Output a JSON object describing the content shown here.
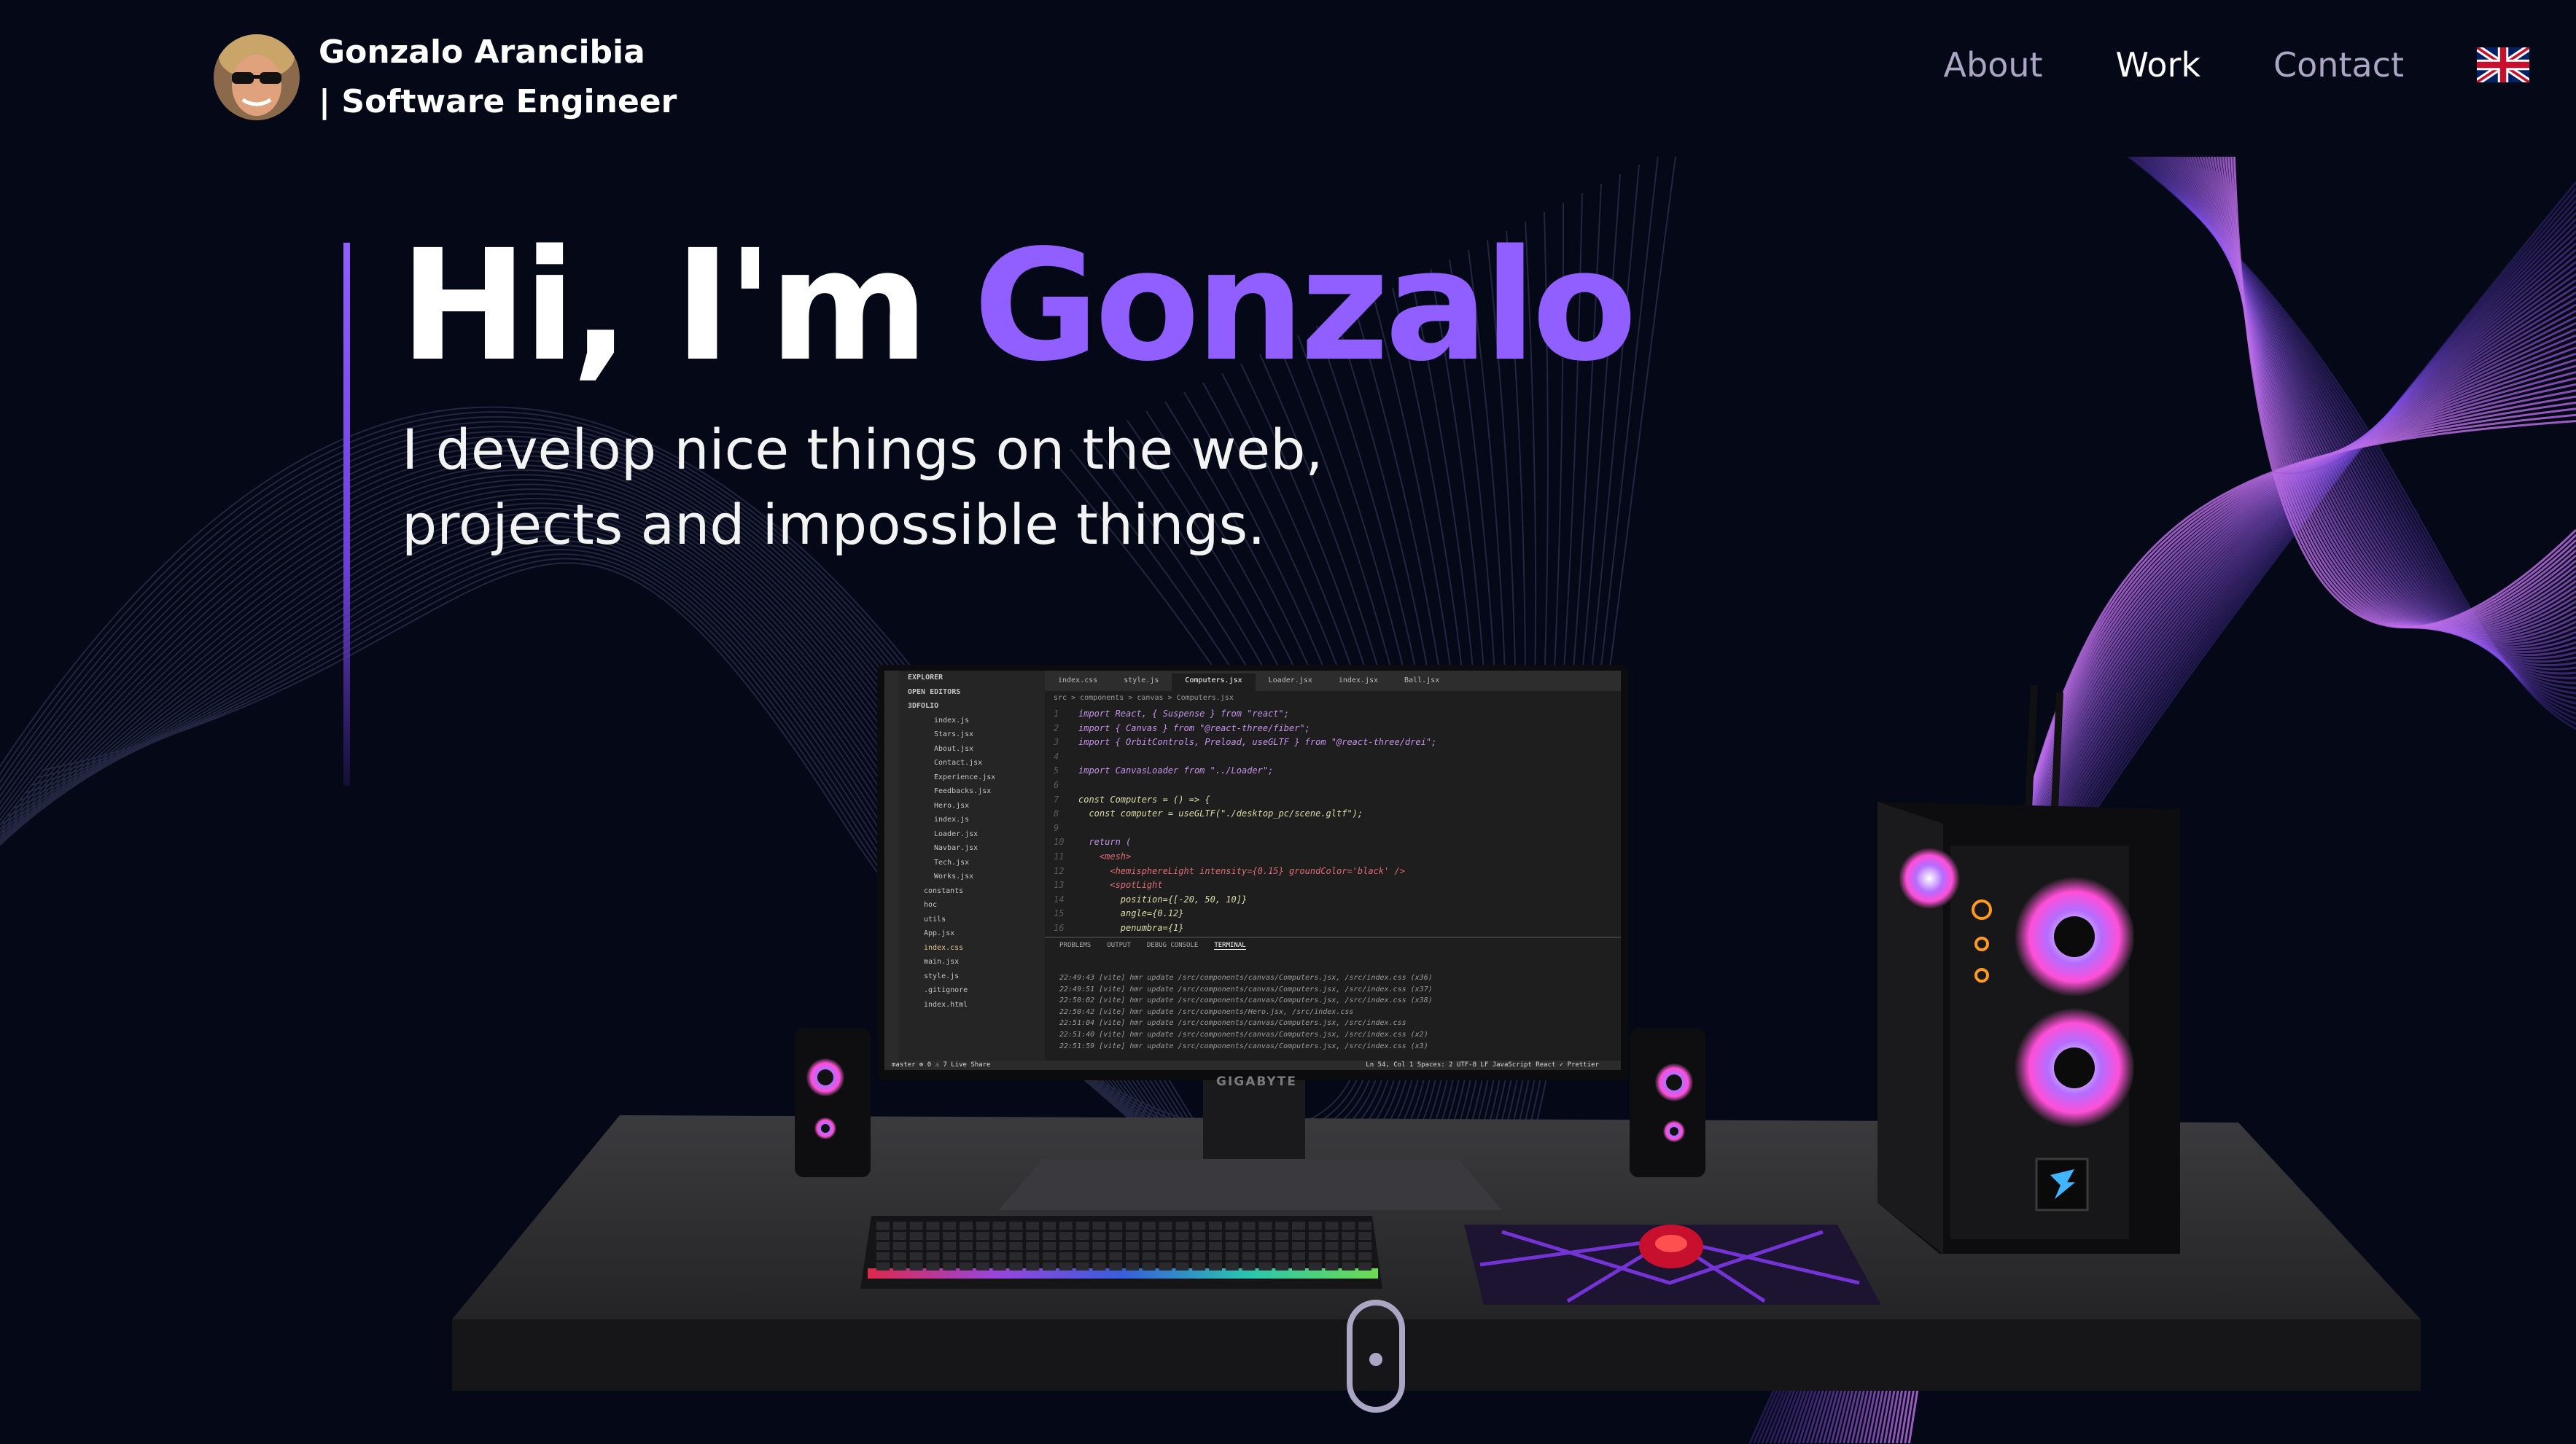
{
  "nav": {
    "name_line1": "Gonzalo Arancibia",
    "name_line2": "| Software Engineer",
    "links": [
      {
        "label": "About",
        "active": false
      },
      {
        "label": "Work",
        "active": true
      },
      {
        "label": "Contact",
        "active": false
      }
    ],
    "language_flag": "uk-flag-icon"
  },
  "hero": {
    "greeting": "Hi, I'm ",
    "name": "Gonzalo",
    "subtitle_line1": "I develop nice things on the web,",
    "subtitle_line2": "projects and impossible things."
  },
  "editor": {
    "tabs": [
      "index.css",
      "style.js",
      "Computers.jsx",
      "Loader.jsx",
      "index.jsx",
      "Ball.jsx"
    ],
    "breadcrumb": "src > components > canvas > Computers.jsx",
    "explorer_title": "EXPLORER",
    "open_editors": "OPEN EDITORS",
    "project": "3DFOLIO",
    "files": [
      "index.js",
      "Stars.jsx",
      "About.jsx",
      "Contact.jsx",
      "Experience.jsx",
      "Feedbacks.jsx",
      "Hero.jsx",
      "index.js",
      "Loader.jsx",
      "Navbar.jsx",
      "Tech.jsx",
      "Works.jsx",
      "constants",
      "hoc",
      "utils",
      "App.jsx",
      "index.css",
      "main.jsx",
      "style.js",
      ".gitignore",
      "index.html"
    ],
    "code_lines": [
      "import React, { Suspense } from \"react\";",
      "import { Canvas } from \"@react-three/fiber\";",
      "import { OrbitControls, Preload, useGLTF } from \"@react-three/drei\";",
      "",
      "import CanvasLoader from \"../Loader\";",
      "",
      "const Computers = () => {",
      "  const computer = useGLTF(\"./desktop_pc/scene.gltf\");",
      "",
      "  return (",
      "    <mesh>",
      "      <hemisphereLight intensity={0.15} groundColor='black' />",
      "      <spotLight",
      "        position={[-20, 50, 10]}",
      "        angle={0.12}",
      "        penumbra={1}"
    ],
    "panel_tabs": [
      "PROBLEMS",
      "OUTPUT",
      "DEBUG CONSOLE",
      "TERMINAL"
    ],
    "terminal_lines": [
      "22:49:43 [vite] hmr update /src/components/canvas/Computers.jsx, /src/index.css (x36)",
      "22:49:51 [vite] hmr update /src/components/canvas/Computers.jsx, /src/index.css (x37)",
      "22:50:02 [vite] hmr update /src/components/canvas/Computers.jsx, /src/index.css (x38)",
      "22:50:42 [vite] hmr update /src/components/Hero.jsx, /src/index.css",
      "22:51:04 [vite] hmr update /src/components/canvas/Computers.jsx, /src/index.css",
      "22:51:40 [vite] hmr update /src/components/canvas/Computers.jsx, /src/index.css (x2)",
      "22:51:59 [vite] hmr update /src/components/canvas/Computers.jsx, /src/index.css (x3)"
    ],
    "status_left": "master  ⊗ 0 ⚠ 7  Live Share",
    "status_right": "Ln 54, Col 1  Spaces: 2  UTF-8  LF  JavaScript React  ✓ Prettier",
    "monitor_brand": "GIGABYTE"
  },
  "colors": {
    "background": "#050816",
    "accent": "#915eff",
    "text_secondary": "#aaa6c3"
  }
}
